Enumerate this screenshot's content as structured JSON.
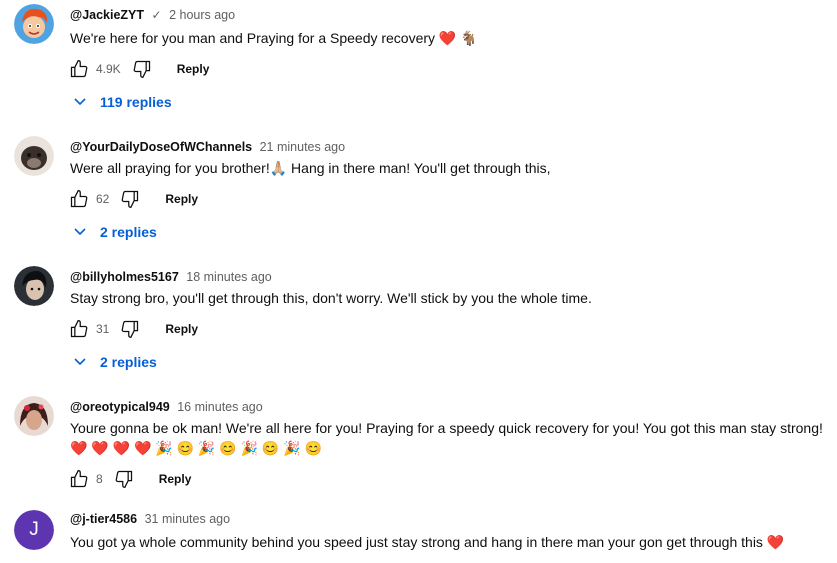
{
  "comments": [
    {
      "author": "@JackieZYT",
      "verified": "✓",
      "time": "2 hours ago",
      "text": "We're here for you man and Praying for a Speedy recovery ❤️ 🐐",
      "likes": "4.9K",
      "reply_label": "Reply",
      "replies_label": "119 replies"
    },
    {
      "author": "@YourDailyDoseOfWChannels",
      "time": "21 minutes ago",
      "text": "Were all praying for you brother!🙏🏼  Hang in there man! You'll get through this,",
      "likes": "62",
      "reply_label": "Reply",
      "replies_label": "2 replies"
    },
    {
      "author": "@billyholmes5167",
      "time": "18 minutes ago",
      "text": "Stay strong bro, you'll get through this, don't worry. We'll stick by you the whole time.",
      "likes": "31",
      "reply_label": "Reply",
      "replies_label": "2 replies"
    },
    {
      "author": "@oreotypical949",
      "time": "16 minutes ago",
      "text": "Youre gonna be ok man! We're all here for you! Praying for a speedy quick recovery for you! You got this man stay strong!",
      "text_line2": "❤️ ❤️ ❤️ ❤️ 🎉 😊 🎉 😊 🎉 😊 🎉 😊",
      "likes": "8",
      "reply_label": "Reply"
    },
    {
      "author": "@j-tier4586",
      "avatar_letter": "J",
      "time": "31 minutes ago",
      "text": "You got ya whole community behind you speed just stay strong and hang in there man your gon get through this ❤️"
    }
  ],
  "colors": {
    "link_blue": "#065fd4",
    "meta_gray": "#606060",
    "avatar_purple": "#5e35b1"
  },
  "icons": [
    "thumbs-up-icon",
    "thumbs-down-icon",
    "chevron-down-icon",
    "verified-check-icon"
  ]
}
